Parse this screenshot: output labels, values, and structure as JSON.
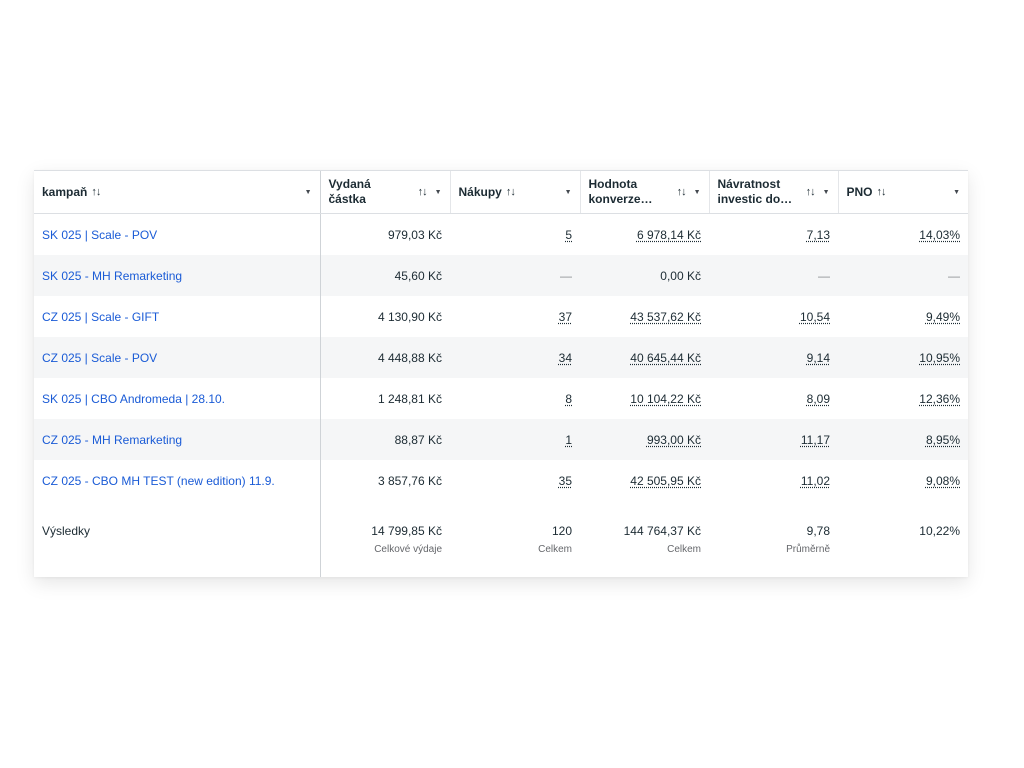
{
  "columns": [
    {
      "label": "kampaň",
      "sort": "↑↓"
    },
    {
      "label": "Vydaná částka",
      "sort": "↑↓"
    },
    {
      "label": "Nákupy",
      "sort": "↑↓"
    },
    {
      "label": "Hodnota konverze…",
      "sort": "↑↓"
    },
    {
      "label": "Návratnost investic do…",
      "sort": "↑↓"
    },
    {
      "label": "PNO",
      "sort": "↑↓"
    }
  ],
  "rows": [
    {
      "name": "SK 025 | Scale - POV",
      "spent": "979,03 Kč",
      "purchases": "5",
      "value": "6 978,14 Kč",
      "roas": "7,13",
      "pno": "14,03%"
    },
    {
      "name": "SK 025 - MH Remarketing",
      "spent": "45,60 Kč",
      "purchases": "—",
      "value": "0,00 Kč",
      "roas": "—",
      "pno": "—"
    },
    {
      "name": "CZ 025 | Scale - GIFT",
      "spent": "4 130,90 Kč",
      "purchases": "37",
      "value": "43 537,62 Kč",
      "roas": "10,54",
      "pno": "9,49%"
    },
    {
      "name": "CZ 025 | Scale - POV",
      "spent": "4 448,88 Kč",
      "purchases": "34",
      "value": "40 645,44 Kč",
      "roas": "9,14",
      "pno": "10,95%"
    },
    {
      "name": "SK 025 | CBO Andromeda | 28.10.",
      "spent": "1 248,81 Kč",
      "purchases": "8",
      "value": "10 104,22 Kč",
      "roas": "8,09",
      "pno": "12,36%"
    },
    {
      "name": "CZ 025 - MH Remarketing",
      "spent": "88,87 Kč",
      "purchases": "1",
      "value": "993,00 Kč",
      "roas": "11,17",
      "pno": "8,95%"
    },
    {
      "name": "CZ 025 - CBO MH TEST (new edition) 11.9.",
      "spent": "3 857,76 Kč",
      "purchases": "35",
      "value": "42 505,95 Kč",
      "roas": "11,02",
      "pno": "9,08%"
    }
  ],
  "totals": {
    "label": "Výsledky",
    "spent": "14 799,85 Kč",
    "spent_sub": "Celkové výdaje",
    "purchases": "120",
    "purchases_sub": "Celkem",
    "value": "144 764,37 Kč",
    "value_sub": "Celkem",
    "roas": "9,78",
    "roas_sub": "Průměrně",
    "pno": "10,22%"
  },
  "colors": {
    "link": "#1a5bd6",
    "text": "#1c2b33",
    "stripe": "#f5f6f7",
    "muted": "#65676b"
  }
}
